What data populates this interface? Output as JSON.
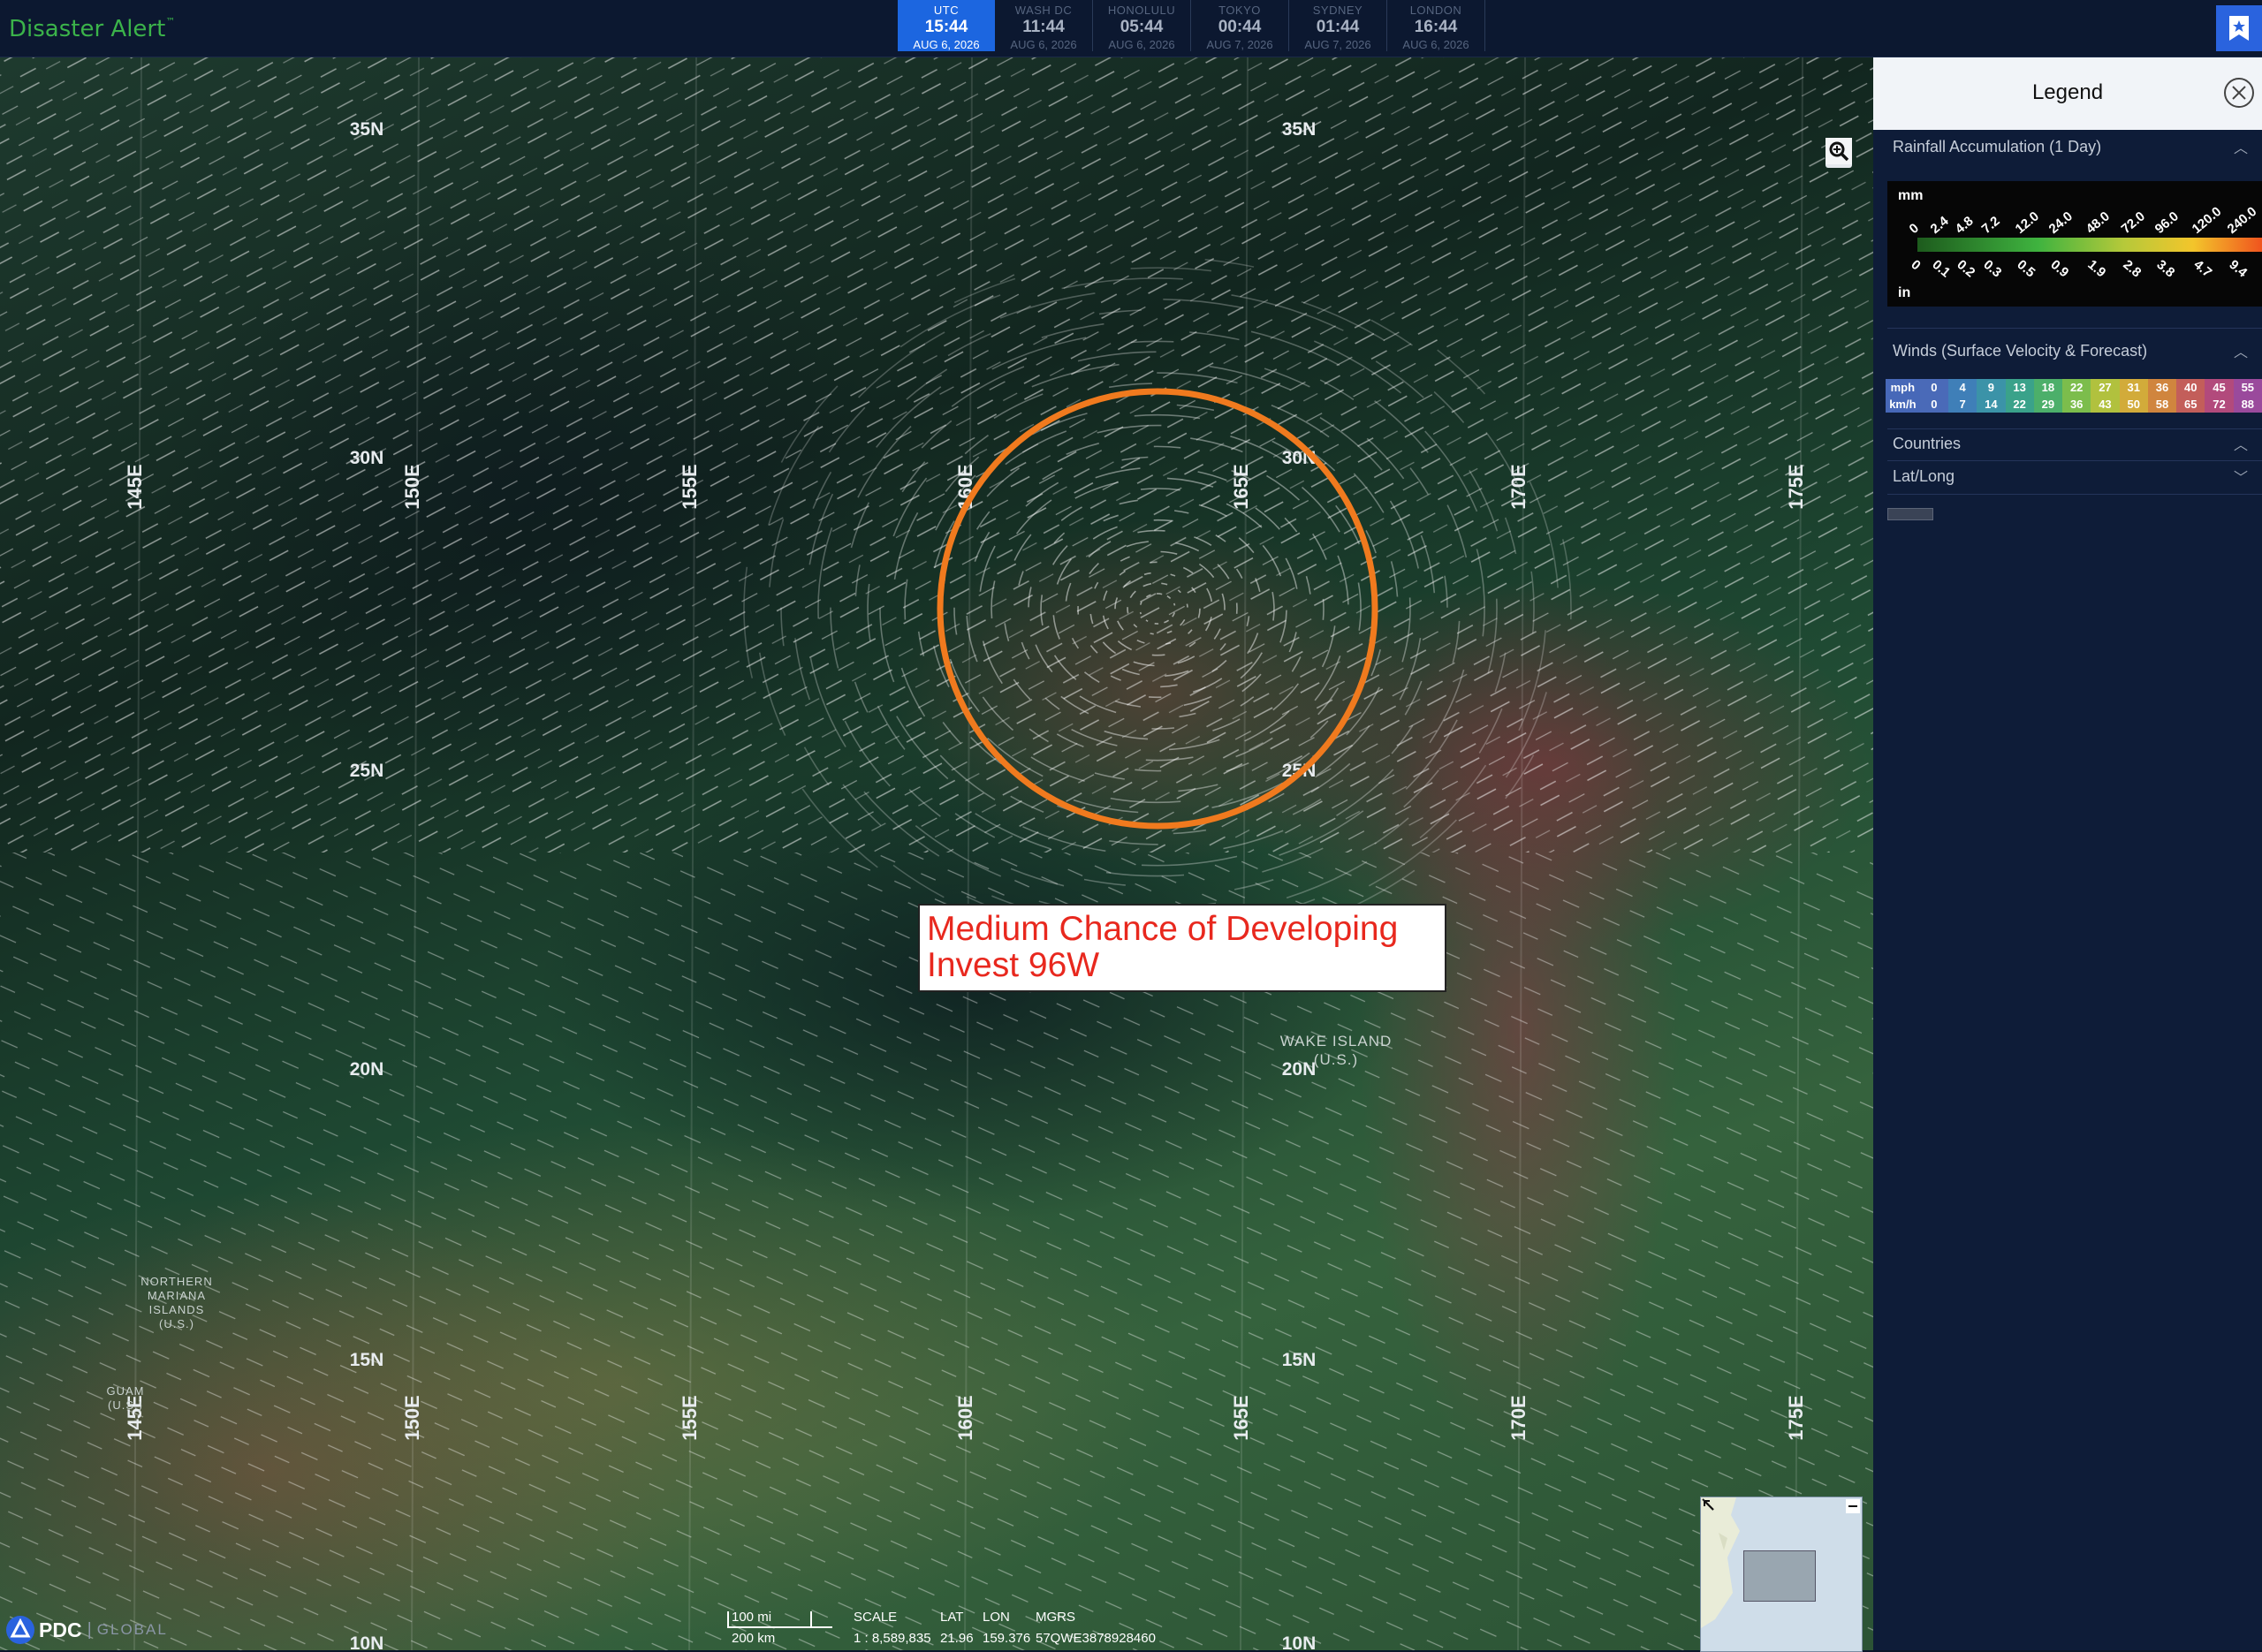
{
  "app": {
    "title": "Disaster Alert",
    "trademark": "™"
  },
  "clocks": [
    {
      "city": "UTC",
      "time": "15:44",
      "date": "AUG 6, 2026",
      "active": true
    },
    {
      "city": "WASH DC",
      "time": "11:44",
      "date": "AUG 6, 2026"
    },
    {
      "city": "HONOLULU",
      "time": "05:44",
      "date": "AUG 6, 2026"
    },
    {
      "city": "TOKYO",
      "time": "00:44",
      "date": "AUG 7, 2026"
    },
    {
      "city": "SYDNEY",
      "time": "01:44",
      "date": "AUG 7, 2026"
    },
    {
      "city": "LONDON",
      "time": "16:44",
      "date": "AUG 6, 2026"
    }
  ],
  "map": {
    "latitudes": [
      "35N",
      "30N",
      "25N",
      "20N",
      "15N",
      "10N"
    ],
    "longitudes": [
      "145E",
      "150E",
      "155E",
      "160E",
      "165E",
      "170E",
      "175E"
    ],
    "places": [
      {
        "name": "WAKE ISLAND",
        "sub": "(U.S.)"
      },
      {
        "name": "NORTHERN MARIANA ISLANDS",
        "lines": [
          "NORTHERN",
          "MARIANA",
          "ISLANDS",
          "(U.S.)"
        ]
      },
      {
        "name": "GUAM",
        "lines": [
          "GUAM",
          "(U.S.)"
        ]
      }
    ],
    "annotation": {
      "line1": "Medium Chance of Developing",
      "line2": "Invest 96W",
      "circle_color": "#f07a1e"
    },
    "overlay_colors": {
      "wind_streaks": "#ffffff",
      "heavy_rain": "#9a3a4a",
      "moderate_rain": "#8a8a4a"
    }
  },
  "controls": [
    {
      "name": "street-view-icon"
    },
    {
      "name": "zoom-in-icon"
    },
    {
      "name": "zoom-out-icon"
    },
    {
      "name": "home-icon"
    },
    {
      "name": "rotate-left-icon"
    },
    {
      "name": "rotate-right-icon"
    },
    {
      "name": "pan-icon"
    },
    {
      "name": "zoom-box-icon"
    }
  ],
  "footer": {
    "logo": "PDC",
    "logo_sub": "GLOBAL",
    "scale_mi": "100 mi",
    "scale_km": "200 km",
    "readout_headers": [
      "SCALE",
      "LAT",
      "LON",
      "MGRS"
    ],
    "readout_values": [
      "1 : 8,589,835",
      "21.96",
      "159.376",
      "57QWE3878928460"
    ]
  },
  "legend": {
    "title": "Legend",
    "rainfall": {
      "title": "Rainfall Accumulation (1 Day)",
      "unit_top": "mm",
      "unit_bottom": "in",
      "mm_ticks": [
        "0",
        "2.4",
        "4.8",
        "7.2",
        "12.0",
        "24.0",
        "48.0",
        "72.0",
        "96.0",
        "120.0",
        "240.0"
      ],
      "in_ticks": [
        "0",
        "0.1",
        "0.2",
        "0.3",
        "0.5",
        "0.9",
        "1.9",
        "2.8",
        "3.8",
        "4.7",
        "9.4"
      ]
    },
    "winds": {
      "title": "Winds (Surface Velocity & Forecast)",
      "mph_label": "mph",
      "kmh_label": "km/h",
      "mph": [
        "0",
        "4",
        "9",
        "13",
        "18",
        "22",
        "27",
        "31",
        "36",
        "40",
        "45",
        "55"
      ],
      "kmh": [
        "0",
        "7",
        "14",
        "22",
        "29",
        "36",
        "43",
        "50",
        "58",
        "65",
        "72",
        "88"
      ],
      "colors": [
        "#4a6ab8",
        "#3f7fb8",
        "#3b93a8",
        "#3aa28a",
        "#4caf6a",
        "#7cbd4c",
        "#b1c13e",
        "#d2ab3a",
        "#d0853e",
        "#c35e5a",
        "#b24a7c",
        "#9a4a9c"
      ]
    },
    "countries": "Countries",
    "latlong": "Lat/Long"
  }
}
